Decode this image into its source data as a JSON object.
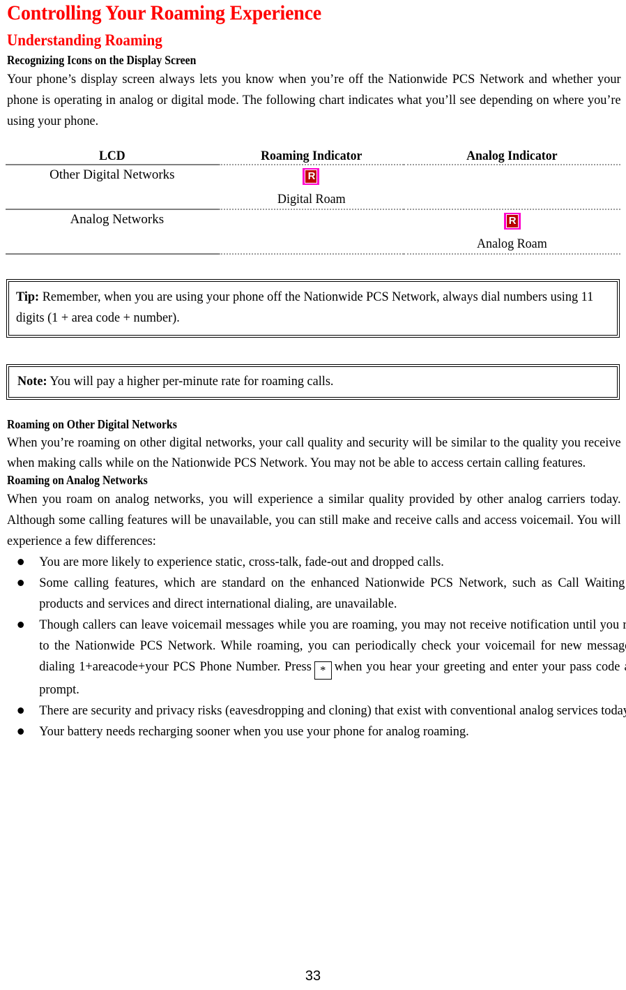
{
  "document": {
    "title": "Controlling Your Roaming Experience",
    "section_heading": "Understanding Roaming",
    "subsection_heading": "Recognizing Icons on the Display Screen",
    "intro_paragraph": "Your phone’s display screen always lets you know when you’re off the Nationwide PCS Network and whether your phone is operating in analog or digital mode. The following chart indicates what you’ll see depending on where you’re using your phone.",
    "page_number": "33"
  },
  "chart_data": {
    "type": "table",
    "title": "",
    "columns": [
      "LCD",
      "Roaming Indicator",
      "Analog Indicator"
    ],
    "rows": [
      {
        "lcd": "Other Digital Networks",
        "roaming_indicator_icon": "roaming-r-icon",
        "roaming_indicator_caption": "Digital Roam",
        "analog_indicator_icon": "",
        "analog_indicator_caption": ""
      },
      {
        "lcd": "Analog Networks",
        "roaming_indicator_icon": "",
        "roaming_indicator_caption": "",
        "analog_indicator_icon": "roaming-r-icon",
        "analog_indicator_caption": "Analog Roam"
      }
    ],
    "icon_glyph": "R",
    "icon_colors": {
      "border": "#ff00cc",
      "fill": "#c00000",
      "glyph": "#ffffff"
    }
  },
  "callouts": {
    "tip": {
      "lead": "Tip:",
      "body": " Remember, when you are using your phone off the Nationwide PCS Network, always dial numbers using 11 digits (1 + area code + number)."
    },
    "note": {
      "lead": "Note:",
      "body": " You will pay a higher per-minute rate for roaming calls."
    }
  },
  "sections": [
    {
      "heading": "Roaming on Other Digital Networks",
      "paragraph": "When you’re roaming on other digital networks, your call quality and security will be similar to the quality you receive when making calls while on the Nationwide PCS Network. You may not be able to access certain calling features."
    },
    {
      "heading": "Roaming on Analog Networks",
      "paragraph": "When you roam on analog networks, you will experience a similar quality provided by other analog carriers today. Although some calling features will be unavailable, you can still make and receive calls and access voicemail. You will experience a few differences:"
    }
  ],
  "bullets": [
    {
      "text": "You are more likely to experience static, cross-talk, fade-out and dropped calls."
    },
    {
      "text": "Some calling features, which are standard on the enhanced Nationwide PCS Network, such as Call Waiting PCS products and services and direct international dialing, are unavailable."
    },
    {
      "text_before_key": "Though callers can leave voicemail messages while you are roaming, you may not receive notification until you return to the Nationwide PCS Network.   While roaming, you can periodically check your voicemail for new messages by dialing 1+areacode+your PCS Phone Number.   Press",
      "key_label": "*",
      "text_after_key": "when you hear your greeting and enter your pass code at the prompt."
    },
    {
      "text": "There are security and privacy risks (eavesdropping and cloning) that exist with conventional analog services today."
    },
    {
      "text": "Your battery needs recharging sooner when you use your phone for analog roaming."
    }
  ],
  "colors": {
    "heading_red": "#ff0000",
    "body_black": "#000000",
    "rule_gray": "#808080"
  }
}
